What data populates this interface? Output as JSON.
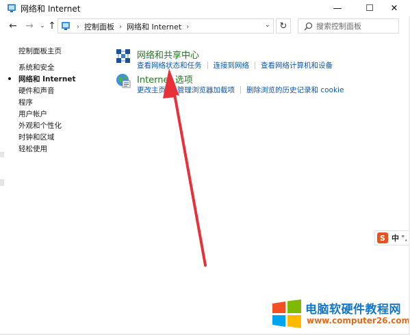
{
  "window": {
    "title": "网络和 Internet",
    "minimize_glyph": "—",
    "maximize_glyph": "☐",
    "close_glyph": "✕"
  },
  "navigation": {
    "back_glyph": "←",
    "forward_glyph": "→",
    "recent_glyph": "⌄",
    "up_glyph": "↑",
    "refresh_glyph": "↻",
    "breadcrumbs": [
      "控制面板",
      "网络和 Internet"
    ],
    "breadcrumb_separator": "›",
    "address_dropdown_glyph": "⌄"
  },
  "search": {
    "placeholder": "搜索控制面板",
    "value": ""
  },
  "sidebar": {
    "items": [
      {
        "label": "控制面板主页"
      },
      {
        "label": "系统和安全"
      },
      {
        "label": "网络和 Internet",
        "active": true
      },
      {
        "label": "硬件和声音"
      },
      {
        "label": "程序"
      },
      {
        "label": "用户帐户"
      },
      {
        "label": "外观和个性化"
      },
      {
        "label": "时钟和区域"
      },
      {
        "label": "轻松使用"
      }
    ]
  },
  "categories": [
    {
      "title": "网络和共享中心",
      "icon": "network-sharing-center-icon",
      "links": [
        "查看网络状态和任务",
        "连接到网络",
        "查看网络计算机和设备"
      ]
    },
    {
      "title": "Internet 选项",
      "icon": "internet-options-icon",
      "links": [
        "更改主页",
        "管理浏览器加载项",
        "删除浏览的历史记录和 cookie"
      ]
    }
  ],
  "ime": {
    "logo": "S",
    "language": "中",
    "punctuation": "°,"
  },
  "watermark": {
    "title": "电脑软硬件教程网",
    "url": "www.computer26.com"
  },
  "colors": {
    "category_title": "#1d7a1d",
    "link": "#0a58b8",
    "annotation_arrow": "#e8303a",
    "watermark_title": "#1577c8",
    "watermark_url": "#e36a1b"
  }
}
